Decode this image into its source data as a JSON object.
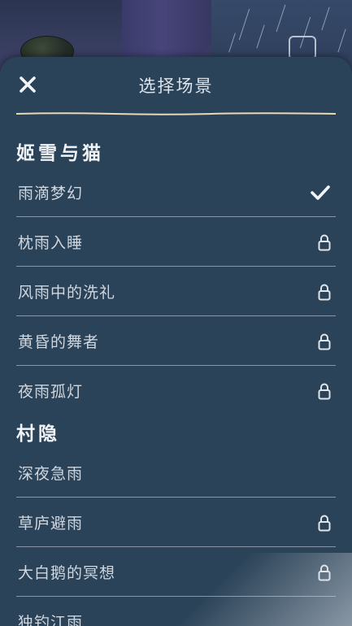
{
  "dialog": {
    "title": "选择场景"
  },
  "sections": [
    {
      "header": "姬雪与猫",
      "items": [
        {
          "label": "雨滴梦幻",
          "status": "selected"
        },
        {
          "label": "枕雨入睡",
          "status": "locked"
        },
        {
          "label": "风雨中的洗礼",
          "status": "locked"
        },
        {
          "label": "黄昏的舞者",
          "status": "locked"
        },
        {
          "label": "夜雨孤灯",
          "status": "locked"
        }
      ]
    },
    {
      "header": "村隐",
      "items": [
        {
          "label": "深夜急雨",
          "status": "unlocked"
        },
        {
          "label": "草庐避雨",
          "status": "locked"
        },
        {
          "label": "大白鹅的冥想",
          "status": "locked"
        },
        {
          "label": "独钓江雨",
          "status": "locked"
        }
      ]
    }
  ],
  "icons": {
    "close": "close-icon",
    "selected": "checkmark-icon",
    "locked": "lock-icon"
  },
  "colors": {
    "sheet_background": "#2b4358",
    "separator": "#8796a6",
    "title_divider": "#e8d9b8",
    "text": "#cfd7e0"
  }
}
